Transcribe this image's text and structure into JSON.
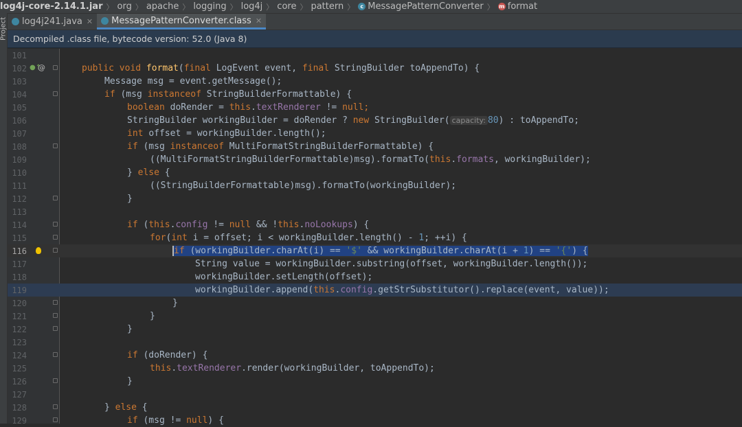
{
  "breadcrumb": {
    "jar": "log4j-core-2.14.1.jar",
    "p1": "org",
    "p2": "apache",
    "p3": "logging",
    "p4": "log4j",
    "p5": "core",
    "p6": "pattern",
    "cls": "MessagePatternConverter",
    "method": "format"
  },
  "sidebar": {
    "project": "Project"
  },
  "tabs": [
    {
      "label": "log4j241.java"
    },
    {
      "label": "MessagePatternConverter.class"
    }
  ],
  "banner": "Decompiled .class file, bytecode version: 52.0 (Java 8)",
  "lines": {
    "n101": "101",
    "n102": "102",
    "n103": "103",
    "n104": "104",
    "n105": "105",
    "n106": "106",
    "n107": "107",
    "n108": "108",
    "n109": "109",
    "n110": "110",
    "n111": "111",
    "n112": "112",
    "n113": "113",
    "n114": "114",
    "n115": "115",
    "n116": "116",
    "n117": "117",
    "n118": "118",
    "n119": "119",
    "n120": "120",
    "n121": "121",
    "n122": "122",
    "n123": "123",
    "n124": "124",
    "n125": "125",
    "n126": "126",
    "n127": "127",
    "n128": "128",
    "n129": "129"
  },
  "code": {
    "l102": {
      "a": "public void ",
      "b": "format",
      "c": "(",
      "d": "final ",
      "e": "LogEvent event, ",
      "f": "final ",
      "g": "StringBuilder toAppendTo) {"
    },
    "l103": "Message msg = event.getMessage();",
    "l104": {
      "a": "if ",
      "b": "(msg ",
      "c": "instanceof ",
      "d": "StringBuilderFormattable) {"
    },
    "l105": {
      "a": "boolean ",
      "b": "doRender = ",
      "c": "this",
      "d": ".",
      "e": "textRenderer",
      "f": " != ",
      "g": "null",
      "h": ";"
    },
    "l106": {
      "a": "StringBuilder workingBuilder = doRender ? ",
      "b": "new ",
      "c": "StringBuilder(",
      "hint": "capacity:",
      "d": "80",
      "e": ") : toAppendTo;"
    },
    "l107": {
      "a": "int ",
      "b": "offset = workingBuilder.length();"
    },
    "l108": {
      "a": "if ",
      "b": "(msg ",
      "c": "instanceof ",
      "d": "MultiFormatStringBuilderFormattable) {"
    },
    "l109": {
      "a": "((MultiFormatStringBuilderFormattable)msg).formatTo(",
      "b": "this",
      "c": ".",
      "d": "formats",
      "e": ", workingBuilder);"
    },
    "l110": {
      "a": "} ",
      "b": "else ",
      "c": "{"
    },
    "l111": "((StringBuilderFormattable)msg).formatTo(workingBuilder);",
    "l112": "}",
    "l114": {
      "a": "if ",
      "b": "(",
      "c": "this",
      "d": ".",
      "e": "config",
      "f": " != ",
      "g": "null",
      "h": " && !",
      "i": "this",
      "j": ".",
      "k": "noLookups",
      "l": ") {"
    },
    "l115": {
      "a": "for",
      "b": "(",
      "c": "int ",
      "d": "i = offset; i < workingBuilder.length() - ",
      "e": "1",
      "f": "; ++i) {"
    },
    "l116": {
      "a": "if ",
      "b": "(workingBuilder.charAt(i) == ",
      "c": "'$'",
      "d": " && workingBuilder.charAt(i + ",
      "e": "1",
      "f": ") == ",
      "g": "'{'",
      "h": ") {"
    },
    "l117": "String value = workingBuilder.substring(offset, workingBuilder.length());",
    "l118": "workingBuilder.setLength(offset);",
    "l119": {
      "a": "workingBuilder.append(",
      "b": "this",
      "c": ".",
      "d": "config",
      "e": ".getStrSubstitutor().replace(event, value));"
    },
    "l120": "}",
    "l121": "}",
    "l122": "}",
    "l124": {
      "a": "if ",
      "b": "(doRender) {"
    },
    "l125": {
      "a": "this",
      "b": ".",
      "c": "textRenderer",
      "d": ".render(workingBuilder, toAppendTo);"
    },
    "l126": "}",
    "l128": {
      "a": "} ",
      "b": "else ",
      "c": "{"
    },
    "l129": {
      "a": "if ",
      "b": "(msg != ",
      "c": "null",
      "d": ") {"
    }
  },
  "colors": {
    "keyword": "#cc7832",
    "method": "#ffc66d",
    "field": "#9876aa",
    "number": "#6897bb",
    "string": "#6a8759",
    "selection": "#214283"
  }
}
